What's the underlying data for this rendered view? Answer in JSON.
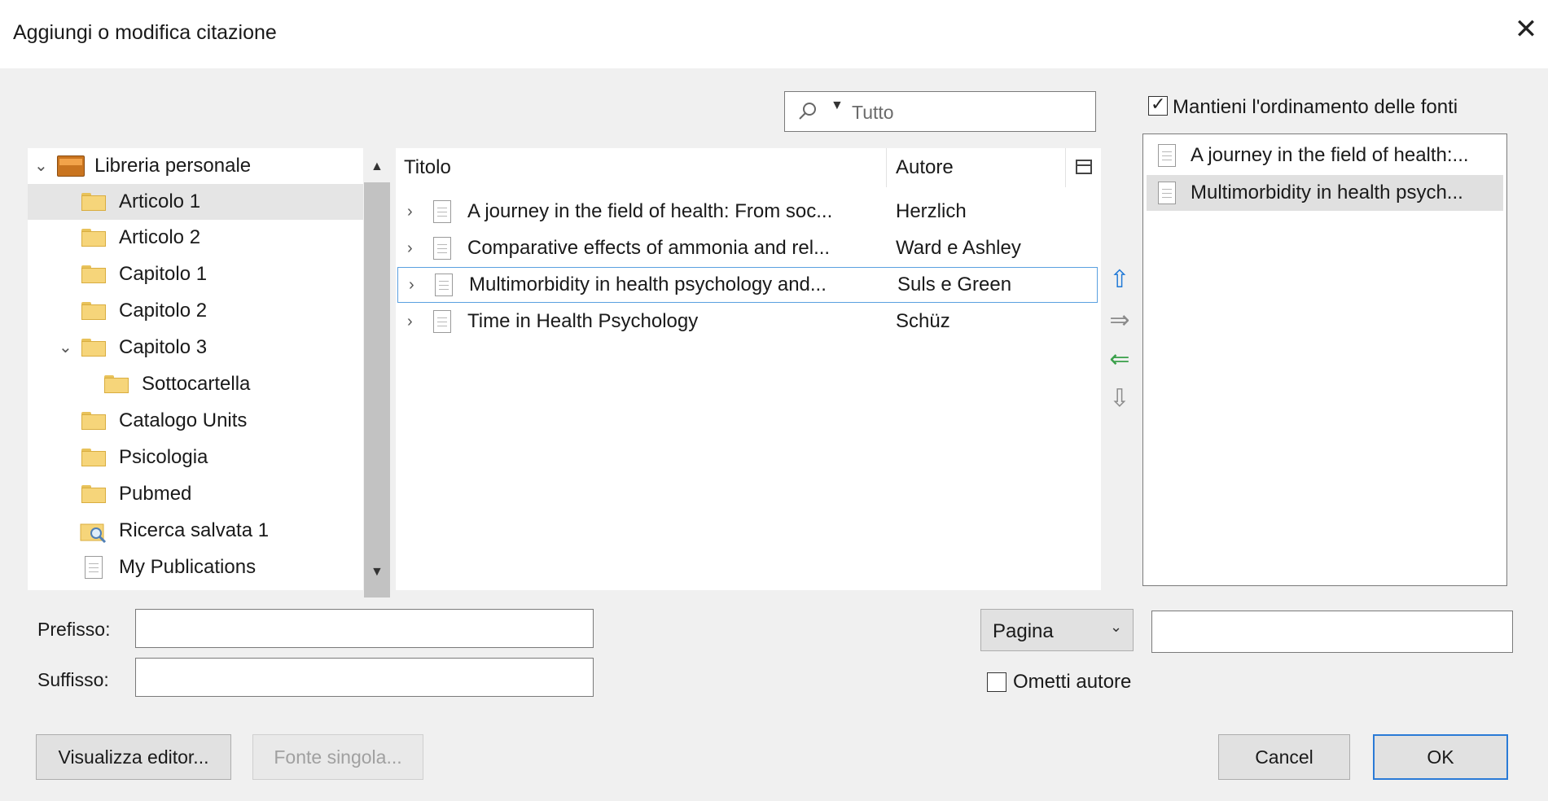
{
  "window": {
    "title": "Aggiungi o modifica citazione",
    "close": "✕"
  },
  "search": {
    "placeholder": "Tutto"
  },
  "tree": {
    "items": [
      {
        "label": "Libreria personale"
      },
      {
        "label": "Articolo 1"
      },
      {
        "label": "Articolo 2"
      },
      {
        "label": "Capitolo 1"
      },
      {
        "label": "Capitolo 2"
      },
      {
        "label": "Capitolo 3"
      },
      {
        "label": "Sottocartella"
      },
      {
        "label": "Catalogo Units"
      },
      {
        "label": "Psicologia"
      },
      {
        "label": "Pubmed"
      },
      {
        "label": "Ricerca salvata 1"
      },
      {
        "label": "My Publications"
      }
    ]
  },
  "list": {
    "columns": {
      "title": "Titolo",
      "author": "Autore"
    },
    "rows": [
      {
        "title": "A journey in the field of health: From soc...",
        "author": "Herzlich"
      },
      {
        "title": "Comparative effects of ammonia and rel...",
        "author": "Ward e Ashley"
      },
      {
        "title": "Multimorbidity in health psychology and...",
        "author": "Suls e Green"
      },
      {
        "title": "Time in Health Psychology",
        "author": "Schüz"
      }
    ]
  },
  "arrows": {
    "up": "⇧",
    "right": "⇒",
    "left": "⇐",
    "down": "⇩"
  },
  "selected": {
    "keep_order_label": "Mantieni l'ordinamento delle fonti",
    "items": [
      {
        "title": "A journey in the field of health:..."
      },
      {
        "title": "Multimorbidity in health psych..."
      }
    ]
  },
  "form": {
    "prefix_label": "Prefisso:",
    "prefix_value": "",
    "suffix_label": "Suffisso:",
    "suffix_value": "",
    "locator": "Pagina",
    "locator_value": "",
    "omit_author_label": "Ometti autore"
  },
  "buttons": {
    "editor": "Visualizza editor...",
    "single": "Fonte singola...",
    "cancel": "Cancel",
    "ok": "OK"
  },
  "colors": {
    "accent": "#2a7ad6",
    "folder": "#f6d57a"
  }
}
